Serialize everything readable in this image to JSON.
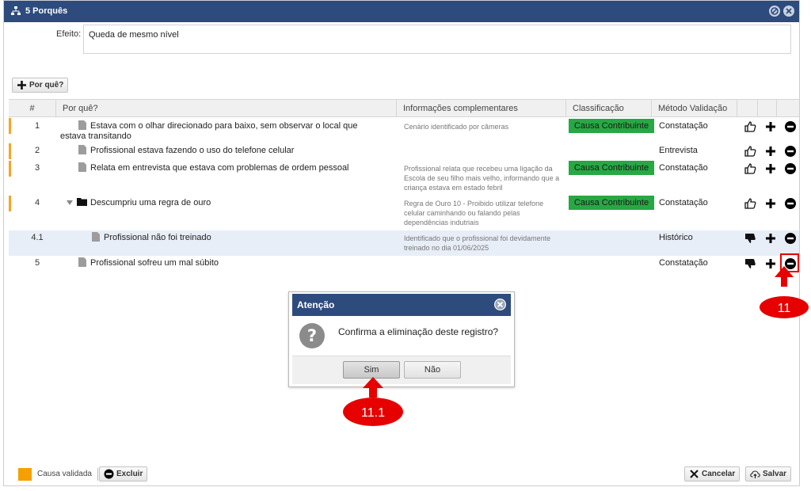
{
  "window": {
    "title": "5 Porquês"
  },
  "efeito": {
    "label": "Efeito:",
    "value": "Queda de mesmo nível"
  },
  "toolbar": {
    "add_label": "Por quê?"
  },
  "grid": {
    "headers": [
      "#",
      "Por quê?",
      "Informações complementares",
      "Classificação",
      "Método Validação"
    ],
    "rows": [
      {
        "num": "1",
        "text": "Estava com o olhar direcionado para baixo, sem observar o local que estava transitando",
        "info": "Cenário identificado por câmeras",
        "class": "Causa Contribuinte",
        "method": "Constatação"
      },
      {
        "num": "2",
        "text": "Profissional estava fazendo o uso do telefone celular",
        "info": "",
        "class": "",
        "method": "Entrevista"
      },
      {
        "num": "3",
        "text": "Relata em entrevista que estava com problemas de ordem pessoal",
        "info": "Profissional relata que recebeu uma ligação da Escola de seu filho mais velho, informando que a criança estava em estado febril",
        "class": "Causa Contribuinte",
        "method": "Constatação"
      },
      {
        "num": "4",
        "text": "Descumpriu uma regra de ouro",
        "info": "Regra de Ouro 10 - Proibido utilizar telefone celular caminhando ou falando pelas dependências indutriais",
        "class": "Causa Contribuinte",
        "method": "Constatação"
      },
      {
        "num": "4.1",
        "text": "Profissional não foi treinado",
        "info": "Identificado que o profissional foi devidamente treinado no dia 01/06/2025",
        "class": "",
        "method": "Histórico"
      },
      {
        "num": "5",
        "text": "Profissional sofreu um mal súbito",
        "info": "",
        "class": "",
        "method": "Constatação"
      }
    ]
  },
  "footer": {
    "legend_label": "Causa validada",
    "delete_label": "Excluir",
    "cancel_label": "Cancelar",
    "save_label": "Salvar"
  },
  "dialog": {
    "title": "Atenção",
    "message": "Confirma a eliminação deste registro?",
    "yes_label": "Sim",
    "no_label": "Não"
  },
  "callouts": {
    "step1": "11",
    "step2": "11.1"
  },
  "colors": {
    "header_blue": "#2d4b7c",
    "accent_orange": "#f5a623",
    "class_green": "#27a844",
    "callout_red": "#e60000"
  }
}
